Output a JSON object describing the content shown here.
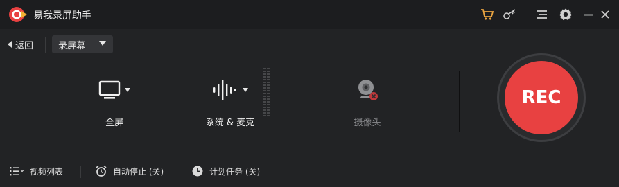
{
  "app": {
    "title": "易我录屏助手"
  },
  "titlebar": {
    "icons": [
      "cart-icon",
      "key-icon",
      "menu-icon",
      "settings-icon",
      "minimize-icon",
      "close-icon"
    ]
  },
  "toolbar": {
    "back_label": "返回",
    "mode_selected": "录屏幕"
  },
  "sources": {
    "screen_label": "全屏",
    "audio_label": "系统 & 麦克",
    "camera_label": "摄像头"
  },
  "record": {
    "label": "REC"
  },
  "bottom": {
    "video_list_label": "视频列表",
    "auto_stop_label": "自动停止 (关)",
    "schedule_label": "计划任务 (关)"
  },
  "colors": {
    "accent": "#e84141",
    "background": "#222325",
    "titlebar": "#1c1d1f"
  }
}
